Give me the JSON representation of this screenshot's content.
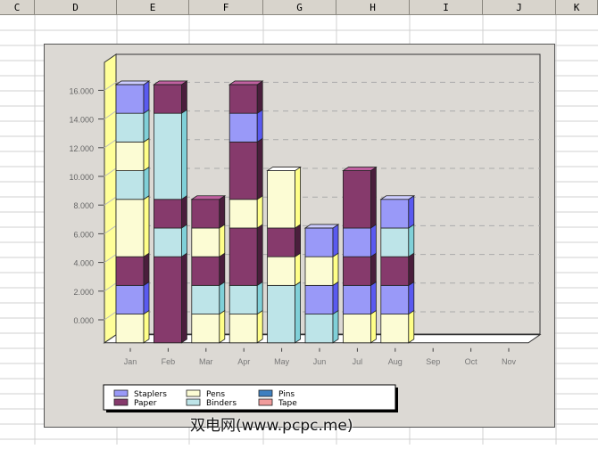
{
  "columns": [
    "C",
    "D",
    "E",
    "F",
    "G",
    "H",
    "I",
    "J",
    "K"
  ],
  "watermark": "双电网(www.pcpc.me)",
  "chart_data": {
    "type": "bar",
    "stacked": true,
    "style": "3d",
    "categories": [
      "Jan",
      "Feb",
      "Mar",
      "Apr",
      "May",
      "Jun",
      "Jul",
      "Aug",
      "Sep",
      "Oct",
      "Nov"
    ],
    "y_ticks": [
      "0.000",
      "2.000",
      "4.000",
      "6.000",
      "8.000",
      "10.000",
      "12.000",
      "14.000",
      "16.000"
    ],
    "ylim": [
      -1600,
      17600
    ],
    "baseline": -1600,
    "grid": "dashed horizontal",
    "colors": {
      "Staplers": "#9999f8",
      "Paper": "#863a6c",
      "Pens": "#fcfcd4",
      "Binders": "#bde4e8",
      "Pins": "#3d7fc0",
      "Tape": "#f09c9c"
    },
    "side_colors": {
      "Staplers": "#5a5af0",
      "Paper": "#4a1e3c",
      "Pens": "#ffff88",
      "Binders": "#80d0d8"
    },
    "legend": {
      "placement": "bottom",
      "entries": [
        "Staplers",
        "Paper",
        "Pens",
        "Binders",
        "Pins",
        "Tape"
      ]
    },
    "stacks": [
      [
        [
          "Pens",
          2000
        ],
        [
          "Staplers",
          2000
        ],
        [
          "Paper",
          2000
        ],
        [
          "Pens",
          4000
        ],
        [
          "Binders",
          2000
        ],
        [
          "Pens",
          2000
        ],
        [
          "Binders",
          2000
        ],
        [
          "Staplers",
          2000
        ]
      ],
      [
        [
          "Paper",
          6000
        ],
        [
          "Binders",
          2000
        ],
        [
          "Paper",
          2000
        ],
        [
          "Binders",
          6000
        ],
        [
          "Paper",
          2000
        ]
      ],
      [
        [
          "Pens",
          2000
        ],
        [
          "Binders",
          2000
        ],
        [
          "Paper",
          2000
        ],
        [
          "Pens",
          2000
        ],
        [
          "Paper",
          2000
        ]
      ],
      [
        [
          "Pens",
          2000
        ],
        [
          "Binders",
          2000
        ],
        [
          "Paper",
          4000
        ],
        [
          "Pens",
          2000
        ],
        [
          "Paper",
          4000
        ],
        [
          "Staplers",
          2000
        ],
        [
          "Paper",
          2000
        ]
      ],
      [
        [
          "Binders",
          4000
        ],
        [
          "Pens",
          2000
        ],
        [
          "Paper",
          2000
        ],
        [
          "Pens",
          4000
        ]
      ],
      [
        [
          "Binders",
          2000
        ],
        [
          "Staplers",
          2000
        ],
        [
          "Pens",
          2000
        ],
        [
          "Staplers",
          2000
        ]
      ],
      [
        [
          "Pens",
          2000
        ],
        [
          "Staplers",
          2000
        ],
        [
          "Paper",
          2000
        ],
        [
          "Staplers",
          2000
        ],
        [
          "Paper",
          4000
        ]
      ],
      [
        [
          "Pens",
          2000
        ],
        [
          "Staplers",
          2000
        ],
        [
          "Paper",
          2000
        ],
        [
          "Binders",
          2000
        ],
        [
          "Staplers",
          2000
        ]
      ],
      [],
      [],
      []
    ]
  }
}
